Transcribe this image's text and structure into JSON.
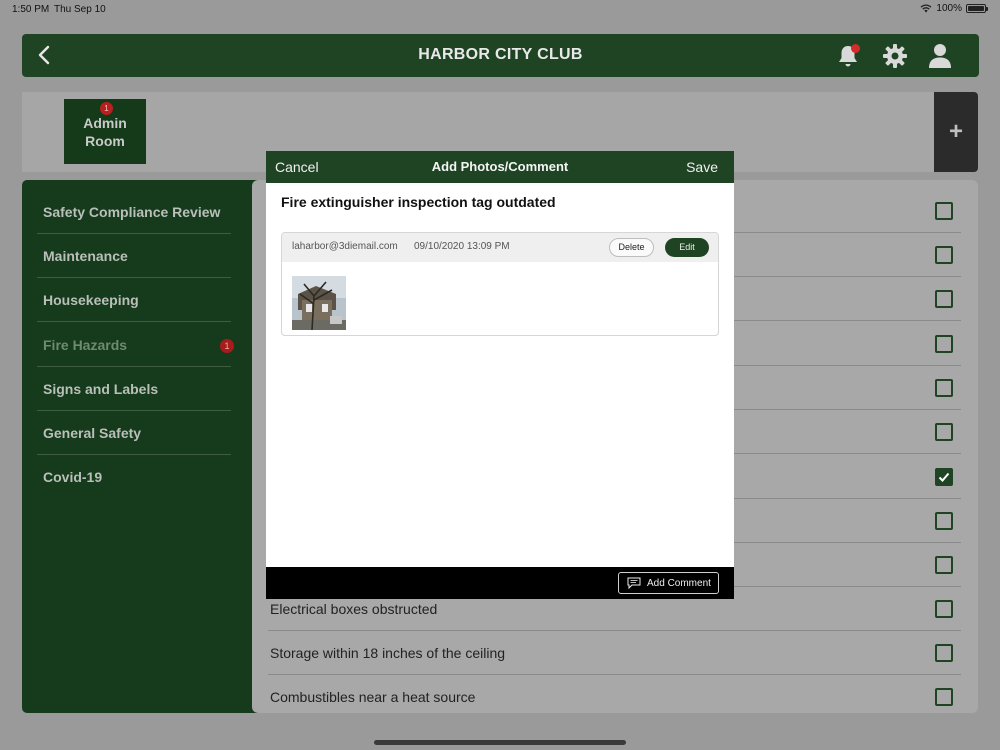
{
  "status_bar": {
    "time": "1:50 PM",
    "date": "Thu Sep 10",
    "battery": "100%"
  },
  "header": {
    "title": "HARBOR CITY CLUB",
    "icons": [
      "back-icon",
      "bell-icon",
      "gear-icon",
      "user-icon"
    ]
  },
  "room": {
    "name_line1": "Admin",
    "name_line2": "Room",
    "badge": "1",
    "add_label": "+"
  },
  "sidebar": {
    "items": [
      {
        "label": "Safety Compliance Review"
      },
      {
        "label": "Maintenance"
      },
      {
        "label": "Housekeeping"
      },
      {
        "label": "Fire Hazards",
        "badge": "1"
      },
      {
        "label": "Signs and Labels"
      },
      {
        "label": "General Safety"
      },
      {
        "label": "Covid-19"
      }
    ]
  },
  "checklist": {
    "items": [
      {
        "label": "",
        "checked": false
      },
      {
        "label": "",
        "checked": false
      },
      {
        "label": "",
        "checked": false
      },
      {
        "label": "",
        "checked": false
      },
      {
        "label": "",
        "checked": false
      },
      {
        "label": "",
        "checked": false
      },
      {
        "label": "",
        "checked": true
      },
      {
        "label": "",
        "checked": false
      },
      {
        "label": "",
        "checked": false
      },
      {
        "label": "Electrical boxes obstructed",
        "checked": false
      },
      {
        "label": "Storage within 18 inches of the ceiling",
        "checked": false
      },
      {
        "label": "Combustibles near a heat source",
        "checked": false
      }
    ]
  },
  "modal": {
    "cancel_label": "Cancel",
    "title": "Add Photos/Comment",
    "save_label": "Save",
    "issue": "Fire extinguisher inspection tag outdated",
    "comment": {
      "email": "laharbor@3diemail.com",
      "timestamp": "09/10/2020 13:09 PM",
      "delete_label": "Delete",
      "edit_label": "Edit"
    },
    "add_comment_label": "Add Comment"
  },
  "colors": {
    "brand_green": "#1f4424",
    "sidebar_green": "#163a1c",
    "badge_red": "#b81f1f"
  }
}
